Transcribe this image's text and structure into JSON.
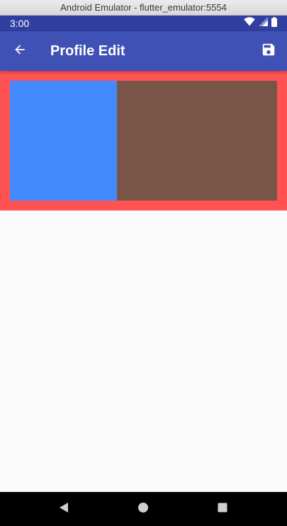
{
  "window": {
    "title": "Android Emulator - flutter_emulator:5554"
  },
  "status_bar": {
    "time": "3:00",
    "icons": [
      "wifi-icon",
      "signal-icon",
      "battery-icon"
    ]
  },
  "app_bar": {
    "title": "Profile Edit",
    "leading_icon": "arrow-back-icon",
    "action_icon": "save-icon"
  },
  "content": {
    "frame_color": "#ff5252",
    "left_panel_color": "#448aff",
    "right_panel_color": "#795548"
  },
  "colors": {
    "status_bar": "#303f9f",
    "app_bar": "#3f51b5",
    "background": "#fafafa",
    "nav_bar": "#000000"
  },
  "nav_bar": {
    "buttons": [
      "nav-back-icon",
      "nav-home-icon",
      "nav-recent-icon"
    ]
  }
}
